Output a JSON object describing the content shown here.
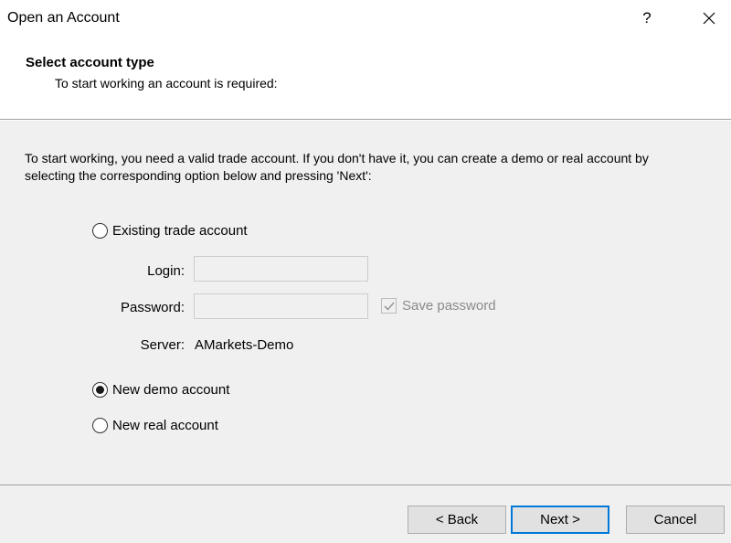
{
  "window": {
    "title": "Open an Account",
    "help_glyph": "?"
  },
  "header": {
    "title": "Select account type",
    "subtitle": "To start working an account is required:"
  },
  "description": "To start working, you need a valid trade account. If you don't have it, you can create a demo or real account by selecting the corresponding option below and pressing 'Next':",
  "options": {
    "existing": {
      "label": "Existing trade account",
      "checked": false
    },
    "demo": {
      "label": "New demo account",
      "checked": true
    },
    "real": {
      "label": "New real account",
      "checked": false
    }
  },
  "fields": {
    "login_label": "Login:",
    "login_value": "",
    "password_label": "Password:",
    "password_value": "",
    "save_password_label": "Save password",
    "save_password_checked": true,
    "server_label": "Server:",
    "server_value": "AMarkets-Demo"
  },
  "buttons": {
    "back": "< Back",
    "next": "Next >",
    "cancel": "Cancel"
  }
}
